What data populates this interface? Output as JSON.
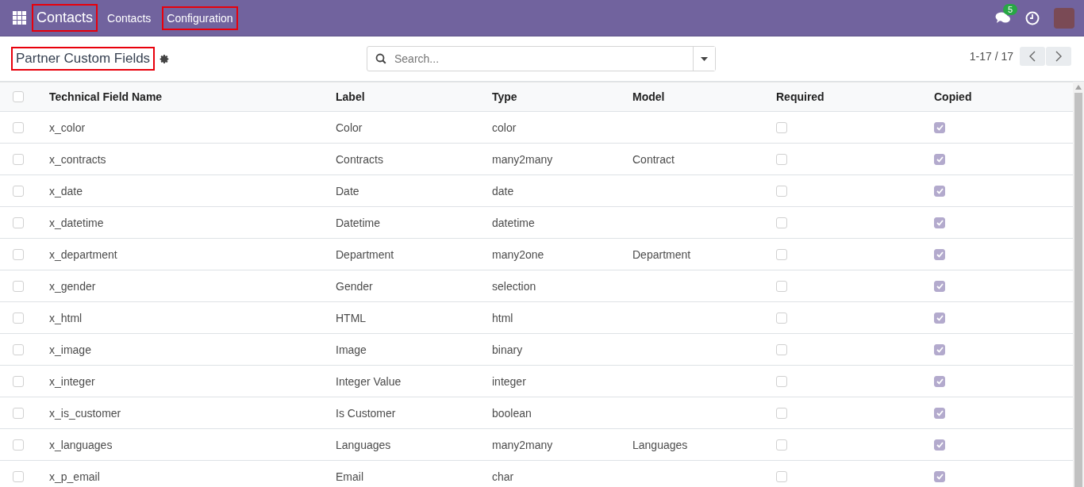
{
  "navbar": {
    "app_name": {
      "text": "Contacts",
      "highlighted": true
    },
    "menu": [
      {
        "label": "Contacts",
        "highlighted": false
      },
      {
        "label": "Configuration",
        "highlighted": true
      }
    ],
    "messages_badge": "5"
  },
  "control_panel": {
    "title": {
      "text": "Partner Custom Fields",
      "highlighted": true
    },
    "search": {
      "placeholder": "Search..."
    },
    "pager": "1-17 / 17"
  },
  "table": {
    "columns": [
      "Technical Field Name",
      "Label",
      "Type",
      "Model",
      "Required",
      "Copied"
    ],
    "select_all": false,
    "rows": [
      {
        "selected": false,
        "name": "x_color",
        "label": "Color",
        "type": "color",
        "model": "",
        "required": false,
        "copied": true
      },
      {
        "selected": false,
        "name": "x_contracts",
        "label": "Contracts",
        "type": "many2many",
        "model": "Contract",
        "required": false,
        "copied": true
      },
      {
        "selected": false,
        "name": "x_date",
        "label": "Date",
        "type": "date",
        "model": "",
        "required": false,
        "copied": true
      },
      {
        "selected": false,
        "name": "x_datetime",
        "label": "Datetime",
        "type": "datetime",
        "model": "",
        "required": false,
        "copied": true
      },
      {
        "selected": false,
        "name": "x_department",
        "label": "Department",
        "type": "many2one",
        "model": "Department",
        "required": false,
        "copied": true
      },
      {
        "selected": false,
        "name": "x_gender",
        "label": "Gender",
        "type": "selection",
        "model": "",
        "required": false,
        "copied": true
      },
      {
        "selected": false,
        "name": "x_html",
        "label": "HTML",
        "type": "html",
        "model": "",
        "required": false,
        "copied": true
      },
      {
        "selected": false,
        "name": "x_image",
        "label": "Image",
        "type": "binary",
        "model": "",
        "required": false,
        "copied": true
      },
      {
        "selected": false,
        "name": "x_integer",
        "label": "Integer Value",
        "type": "integer",
        "model": "",
        "required": false,
        "copied": true
      },
      {
        "selected": false,
        "name": "x_is_customer",
        "label": "Is Customer",
        "type": "boolean",
        "model": "",
        "required": false,
        "copied": true
      },
      {
        "selected": false,
        "name": "x_languages",
        "label": "Languages",
        "type": "many2many",
        "model": "Languages",
        "required": false,
        "copied": true
      },
      {
        "selected": false,
        "name": "x_p_email",
        "label": "Email",
        "type": "char",
        "model": "",
        "required": false,
        "copied": true
      }
    ]
  }
}
